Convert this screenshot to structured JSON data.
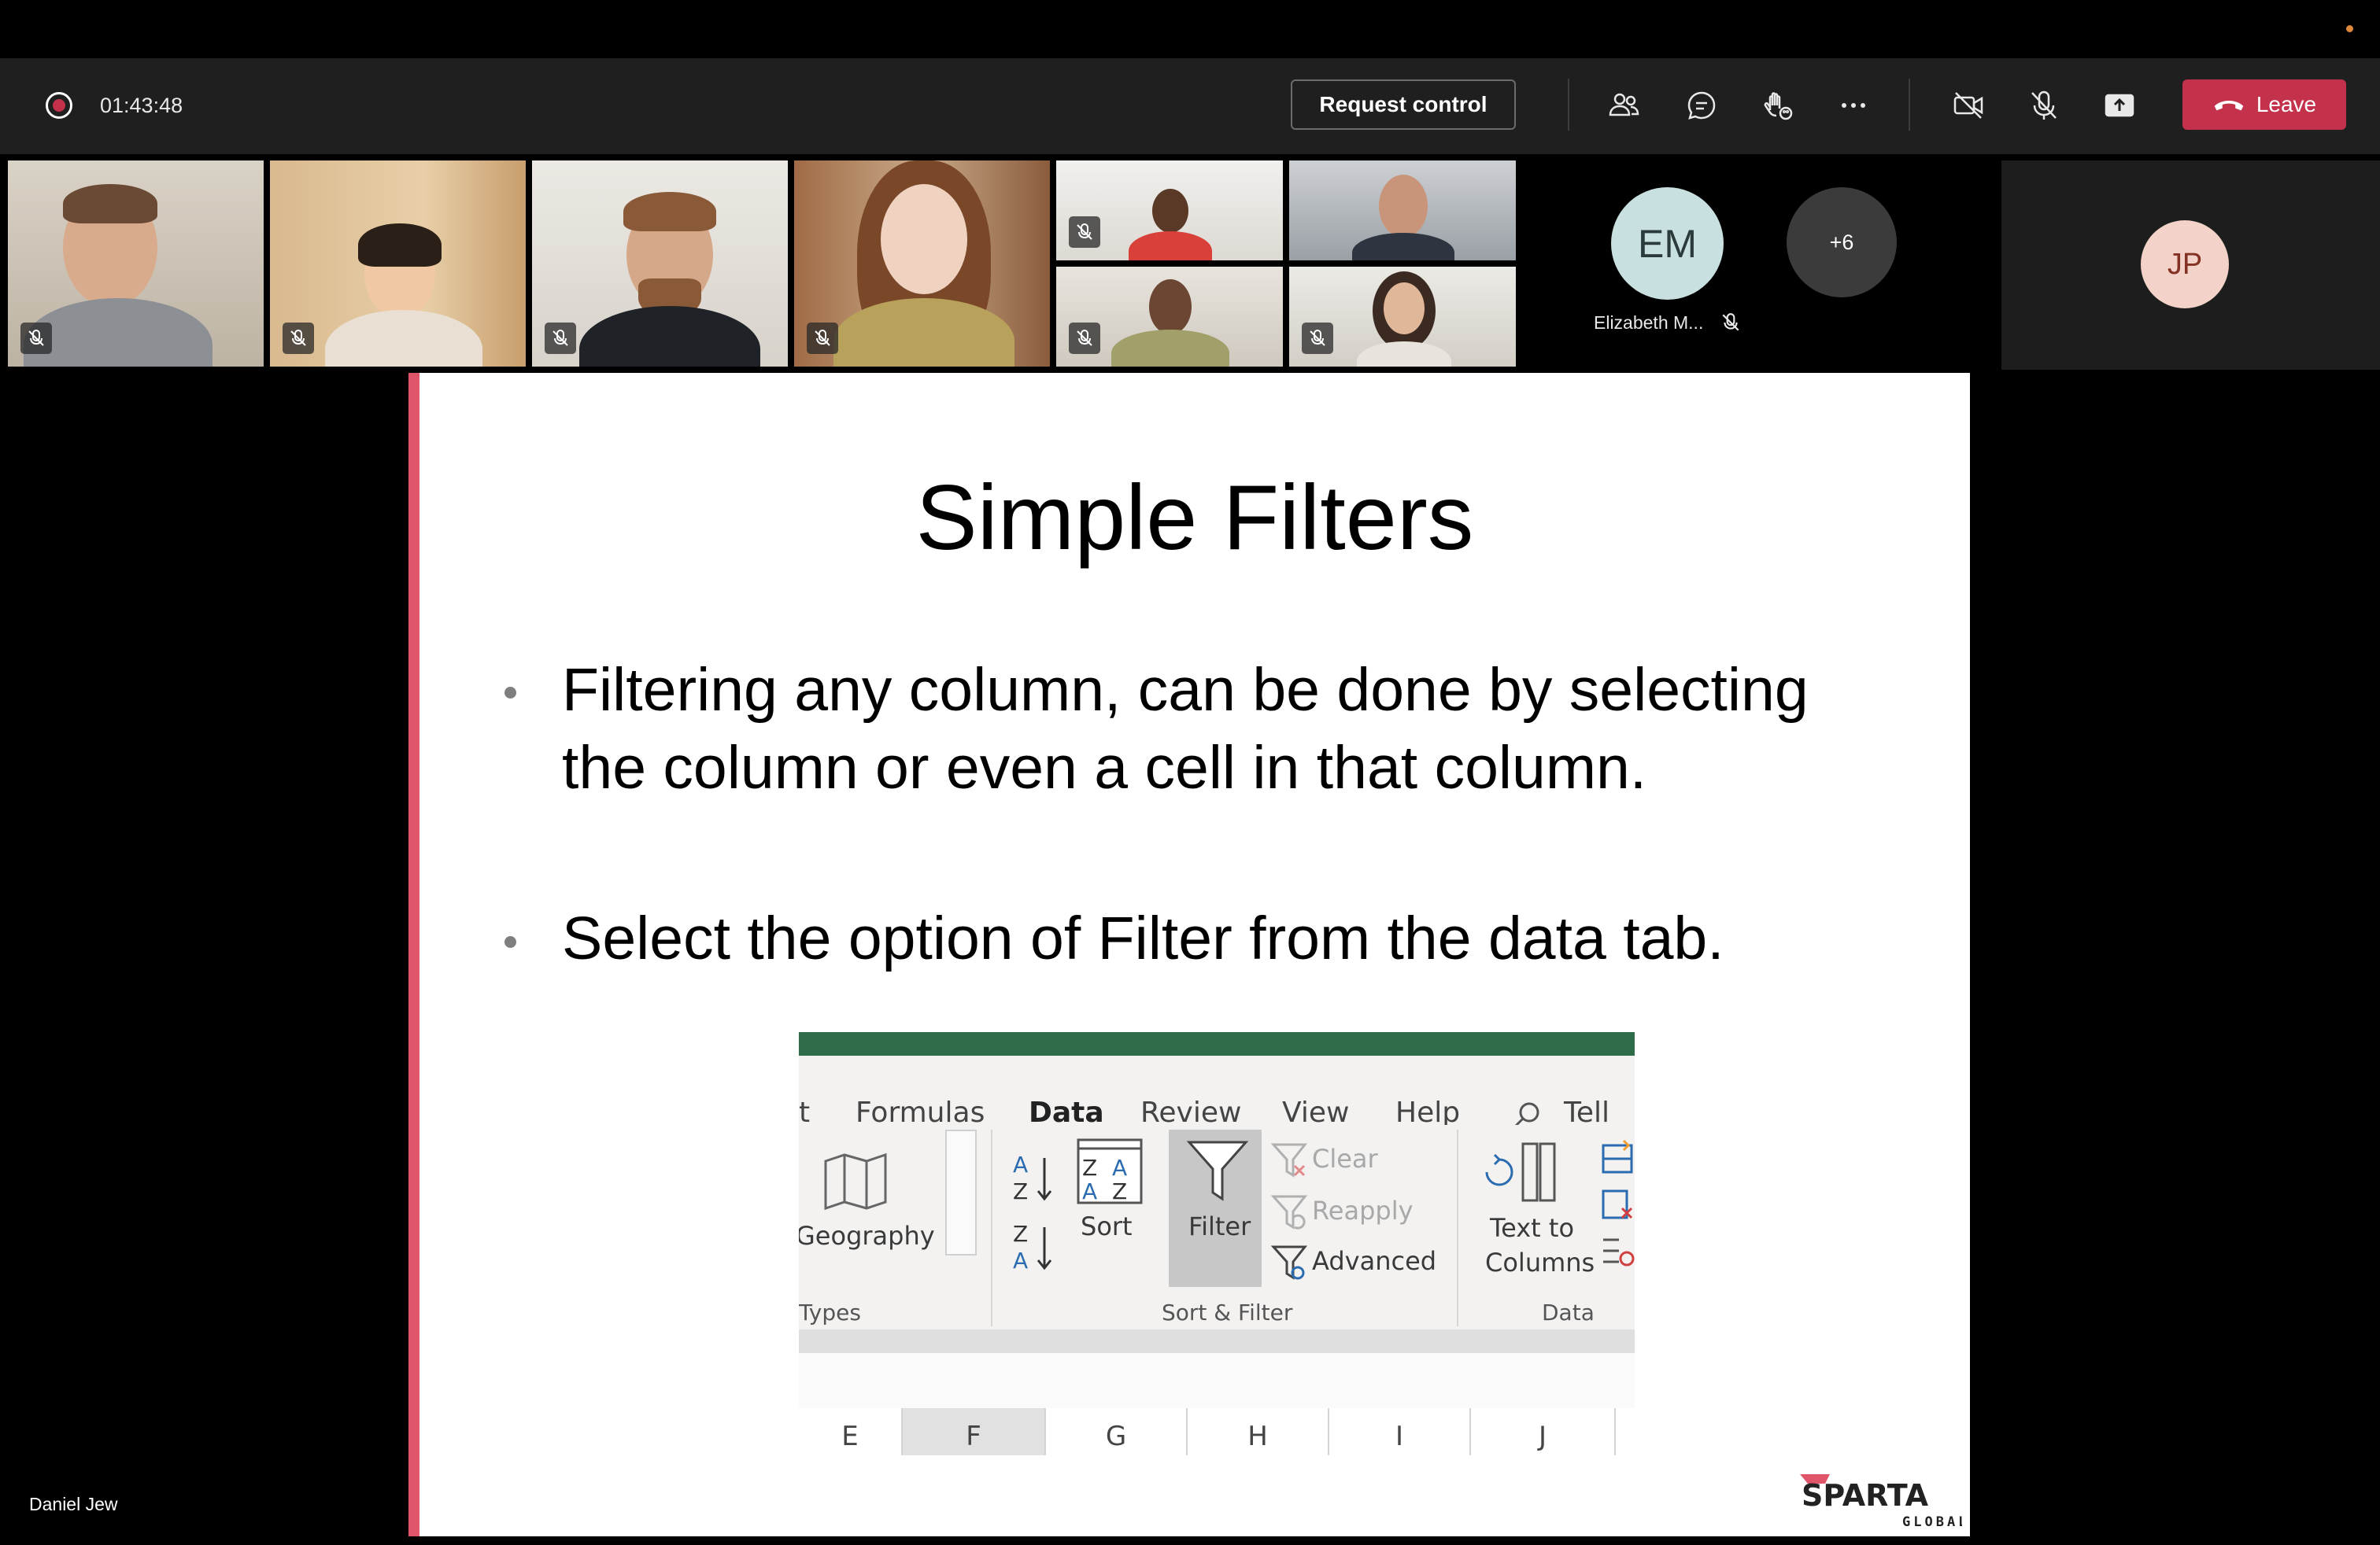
{
  "meeting": {
    "timer": "01:43:48",
    "request_control_label": "Request control",
    "leave_label": "Leave",
    "tools": [
      "people-icon",
      "chat-icon",
      "reactions-icon",
      "more-icon",
      "camera-off-icon",
      "mic-off-icon",
      "share-tray-icon"
    ]
  },
  "participants": {
    "em_initials": "EM",
    "em_name": "Elizabeth M...",
    "more_count": "+6",
    "jp_initials": "JP"
  },
  "presenter": {
    "name": "Daniel Jew"
  },
  "slide": {
    "title": "Simple Filters",
    "bullets": [
      "Filtering any column,  can be done by selecting the column or even a cell in that column.",
      "Select the option of Filter from the data tab."
    ],
    "logo_text": "SPARTA",
    "logo_subtext": "GLOBAL",
    "accent_color": "#e0556a"
  },
  "ribbon": {
    "tabs": [
      "t",
      "Formulas",
      "Data",
      "Review",
      "View",
      "Help",
      "Tell n"
    ],
    "active_tab": "Data",
    "geography": "Geography",
    "sort": "Sort",
    "filter": "Filter",
    "clear": "Clear",
    "reapply": "Reapply",
    "advanced": "Advanced",
    "text_to": "Text to",
    "columns": "Columns",
    "group_types": "Types",
    "group_sort_filter": "Sort & Filter",
    "group_data_tools": "Data Too",
    "column_headers": [
      "E",
      "F",
      "G",
      "H",
      "I",
      "J"
    ],
    "accent_color": "#217346"
  },
  "colors": {
    "leave": "#c4314b",
    "active_outline": "#8f8ff5",
    "control_bar": "#1f1f1f"
  }
}
